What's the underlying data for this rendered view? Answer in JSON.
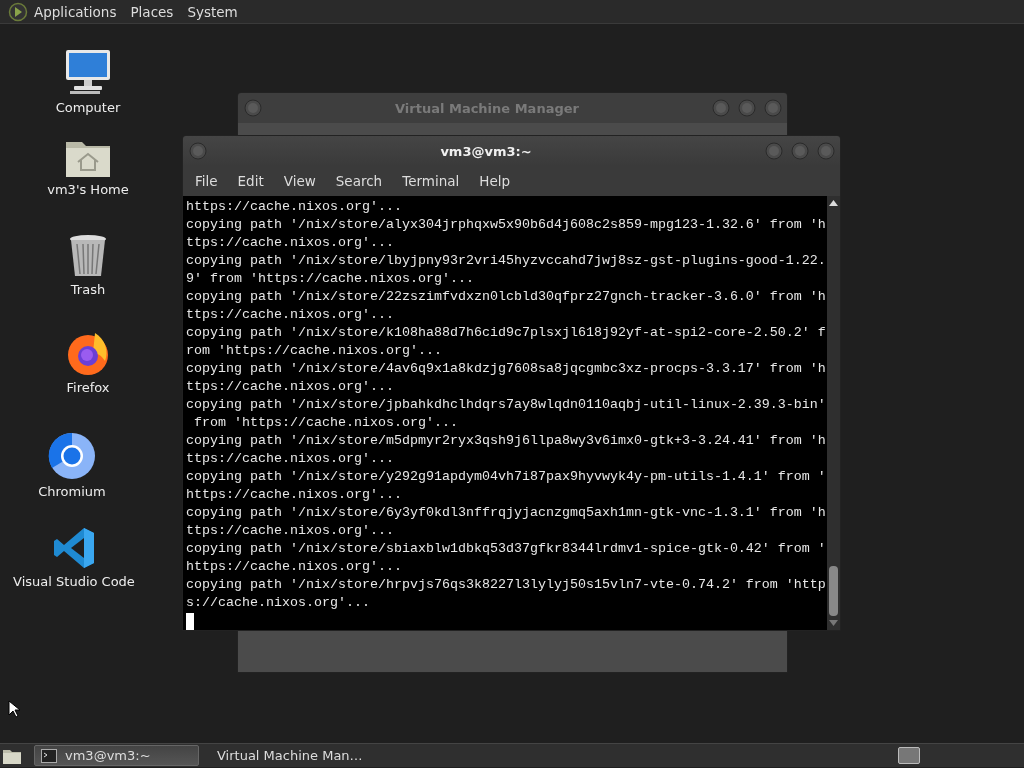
{
  "top_panel": {
    "menus": [
      "Applications",
      "Places",
      "System"
    ]
  },
  "desktop_icons": [
    {
      "label": "Computer",
      "kind": "computer"
    },
    {
      "label": "vm3's Home",
      "kind": "home"
    },
    {
      "label": "Trash",
      "kind": "trash"
    },
    {
      "label": "Firefox",
      "kind": "firefox"
    },
    {
      "label": "Chromium",
      "kind": "chromium"
    },
    {
      "label": "Visual Studio Code",
      "kind": "vscode"
    }
  ],
  "windows": [
    {
      "kind": "manager",
      "title": "Virtual Machine Manager",
      "active": false
    },
    {
      "kind": "terminal",
      "title": "vm3@vm3:~",
      "active": true,
      "menu": [
        "File",
        "Edit",
        "View",
        "Search",
        "Terminal",
        "Help"
      ],
      "lines": [
        "https://cache.nixos.org'...",
        "copying path '/nix/store/alyx304jrphqxw5x90b6d4j608c2s859-mpg123-1.32.6' from 'h",
        "ttps://cache.nixos.org'...",
        "copying path '/nix/store/lbyjpny93r2vri45hyzvccahd7jwj8sz-gst-plugins-good-1.22.",
        "9' from 'https://cache.nixos.org'...",
        "copying path '/nix/store/22zszimfvdxzn0lcbld30qfprz27gnch-tracker-3.6.0' from 'h",
        "ttps://cache.nixos.org'...",
        "copying path '/nix/store/k108ha88d7h6cid9c7plsxjl618j92yf-at-spi2-core-2.50.2' f",
        "rom 'https://cache.nixos.org'...",
        "copying path '/nix/store/4av6q9x1a8kdzjg7608sa8jqcgmbc3xz-procps-3.3.17' from 'h",
        "ttps://cache.nixos.org'...",
        "copying path '/nix/store/jpbahkdhclhdqrs7ay8wlqdn0110aqbj-util-linux-2.39.3-bin'",
        " from 'https://cache.nixos.org'...",
        "copying path '/nix/store/m5dpmyr2ryx3qsh9j6llpa8wy3v6imx0-gtk+3-3.24.41' from 'h",
        "ttps://cache.nixos.org'...",
        "copying path '/nix/store/y292g91apdym04vh7i87pax9hyvwyk4y-pm-utils-1.4.1' from '",
        "https://cache.nixos.org'...",
        "copying path '/nix/store/6y3yf0kdl3nffrqjyjacnzgmq5axh1mn-gtk-vnc-1.3.1' from 'h",
        "ttps://cache.nixos.org'...",
        "copying path '/nix/store/sbiaxblw1dbkq53d37gfkr8344lrdmv1-spice-gtk-0.42' from '",
        "https://cache.nixos.org'...",
        "copying path '/nix/store/hrpvjs76qs3k8227l3lylyj50s15vln7-vte-0.74.2' from 'http",
        "s://cache.nixos.org'..."
      ]
    }
  ],
  "taskbar": {
    "tasks": [
      {
        "label": "vm3@vm3:~",
        "kind": "terminal",
        "selected": true
      },
      {
        "label": "Virtual Machine Man…",
        "kind": "manager",
        "selected": false
      }
    ]
  }
}
